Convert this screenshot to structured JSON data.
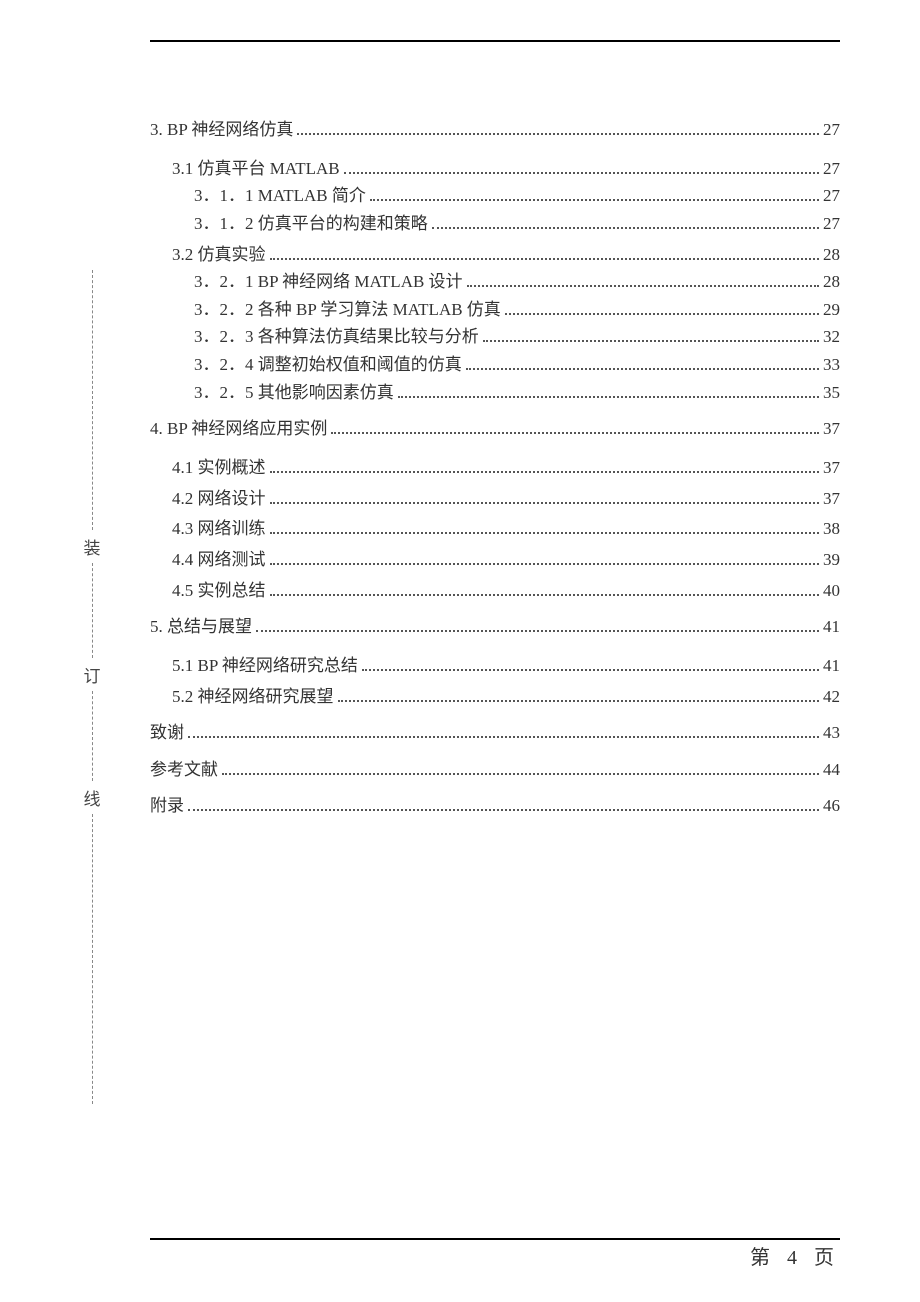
{
  "binding": {
    "char1": "装",
    "char2": "订",
    "char3": "线"
  },
  "footer": {
    "pageLabelPrefix": "第",
    "pageNumber": "4",
    "pageLabelSuffix": "页"
  },
  "toc": {
    "e0": {
      "title": "3. BP 神经网络仿真",
      "page": "27"
    },
    "e1": {
      "title": "3.1 仿真平台 MATLAB",
      "page": "27"
    },
    "e2": {
      "title": "3．1．1 MATLAB 简介",
      "page": "27"
    },
    "e3": {
      "title": "3．1．2 仿真平台的构建和策略",
      "page": "27"
    },
    "e4": {
      "title": "3.2 仿真实验",
      "page": "28"
    },
    "e5": {
      "title": "3．2．1 BP 神经网络 MATLAB 设计",
      "page": "28"
    },
    "e6": {
      "title": "3．2．2 各种 BP 学习算法 MATLAB 仿真",
      "page": "29"
    },
    "e7": {
      "title": "3．2．3 各种算法仿真结果比较与分析",
      "page": "32"
    },
    "e8": {
      "title": "3．2．4 调整初始权值和阈值的仿真",
      "page": "33"
    },
    "e9": {
      "title": "3．2．5 其他影响因素仿真",
      "page": "35"
    },
    "e10": {
      "title": "4. BP 神经网络应用实例",
      "page": "37"
    },
    "e11": {
      "title": "4.1 实例概述",
      "page": "37"
    },
    "e12": {
      "title": "4.2 网络设计",
      "page": "37"
    },
    "e13": {
      "title": "4.3 网络训练",
      "page": "38"
    },
    "e14": {
      "title": "4.4 网络测试",
      "page": "39"
    },
    "e15": {
      "title": "4.5 实例总结",
      "page": "40"
    },
    "e16": {
      "title": "5. 总结与展望",
      "page": "41"
    },
    "e17": {
      "title": "5.1 BP 神经网络研究总结",
      "page": "41"
    },
    "e18": {
      "title": "5.2 神经网络研究展望",
      "page": "42"
    },
    "e19": {
      "title": "致谢",
      "page": "43"
    },
    "e20": {
      "title": "参考文献",
      "page": "44"
    },
    "e21": {
      "title": "附录",
      "page": "46"
    }
  }
}
